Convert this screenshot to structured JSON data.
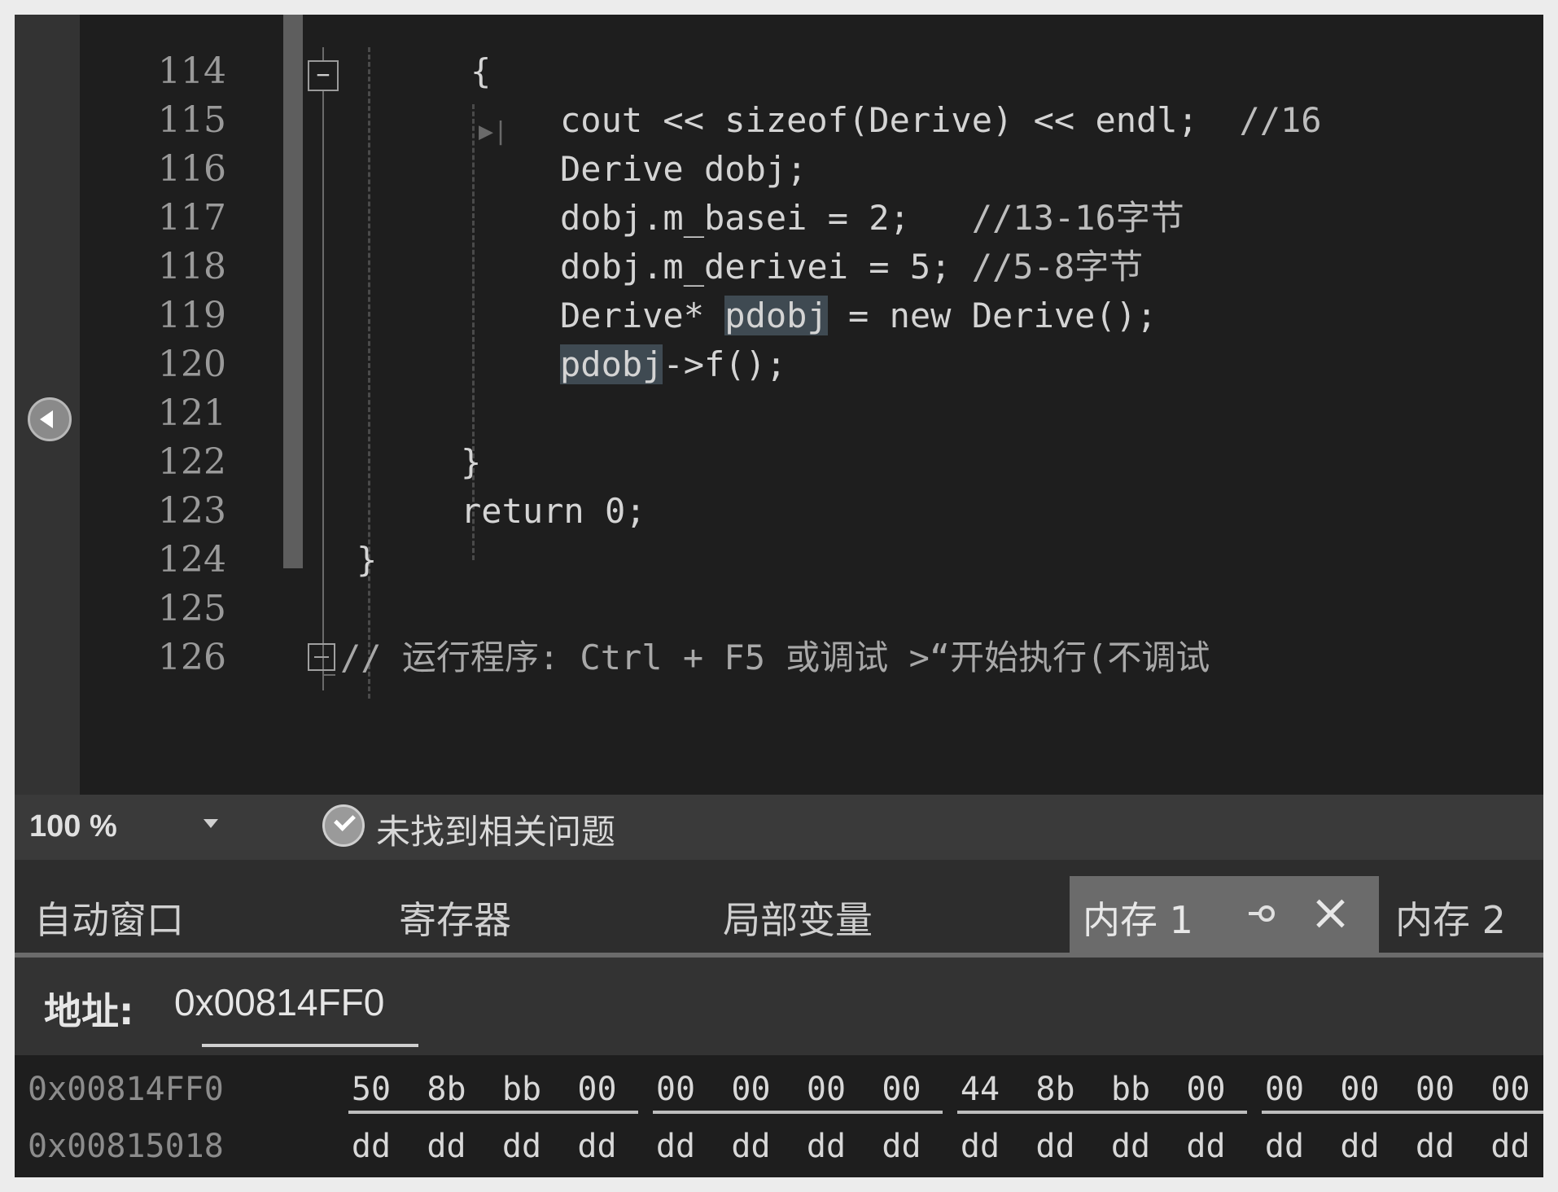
{
  "editor": {
    "line_numbers": [
      "114",
      "115",
      "116",
      "117",
      "118",
      "119",
      "120",
      "121",
      "122",
      "123",
      "124",
      "125",
      "126"
    ],
    "code": {
      "l114": "{",
      "l115_a": "cout << sizeof(Derive) << endl;",
      "l115_b": "//16",
      "l116": "Derive dobj;",
      "l117_a": "dobj.m_basei = 2;",
      "l117_b": "//13-16字节",
      "l118_a": "dobj.m_derivei = 5;",
      "l118_b": "//5-8字节",
      "l119_a": "Derive* ",
      "l119_b": "pdobj",
      "l119_c": " = new Derive();",
      "l120_a": "pdobj",
      "l120_b": "->f();",
      "l122": "}",
      "l123": "return 0;",
      "l124": "}",
      "l126": "// 运行程序: Ctrl + F5 或调试 >“开始执行(不调试"
    }
  },
  "status": {
    "zoom": "100 %",
    "issues": "未找到相关问题"
  },
  "tabs": {
    "auto": "自动窗口",
    "registers": "寄存器",
    "locals": "局部变量",
    "memory1": "内存 1",
    "memory2": "内存 2"
  },
  "memory": {
    "address_label": "地址:",
    "address_value": "0x00814FF0",
    "rows": [
      {
        "address": "0x00814FF0",
        "bytes": [
          "50",
          "8b",
          "bb",
          "00",
          "00",
          "00",
          "00",
          "00",
          "44",
          "8b",
          "bb",
          "00",
          "00",
          "00",
          "00",
          "00"
        ]
      },
      {
        "address": "0x00815018",
        "bytes": [
          "dd",
          "dd",
          "dd",
          "dd",
          "dd",
          "dd",
          "dd",
          "dd",
          "dd",
          "dd",
          "dd",
          "dd",
          "dd",
          "dd",
          "dd",
          "dd"
        ]
      }
    ]
  }
}
